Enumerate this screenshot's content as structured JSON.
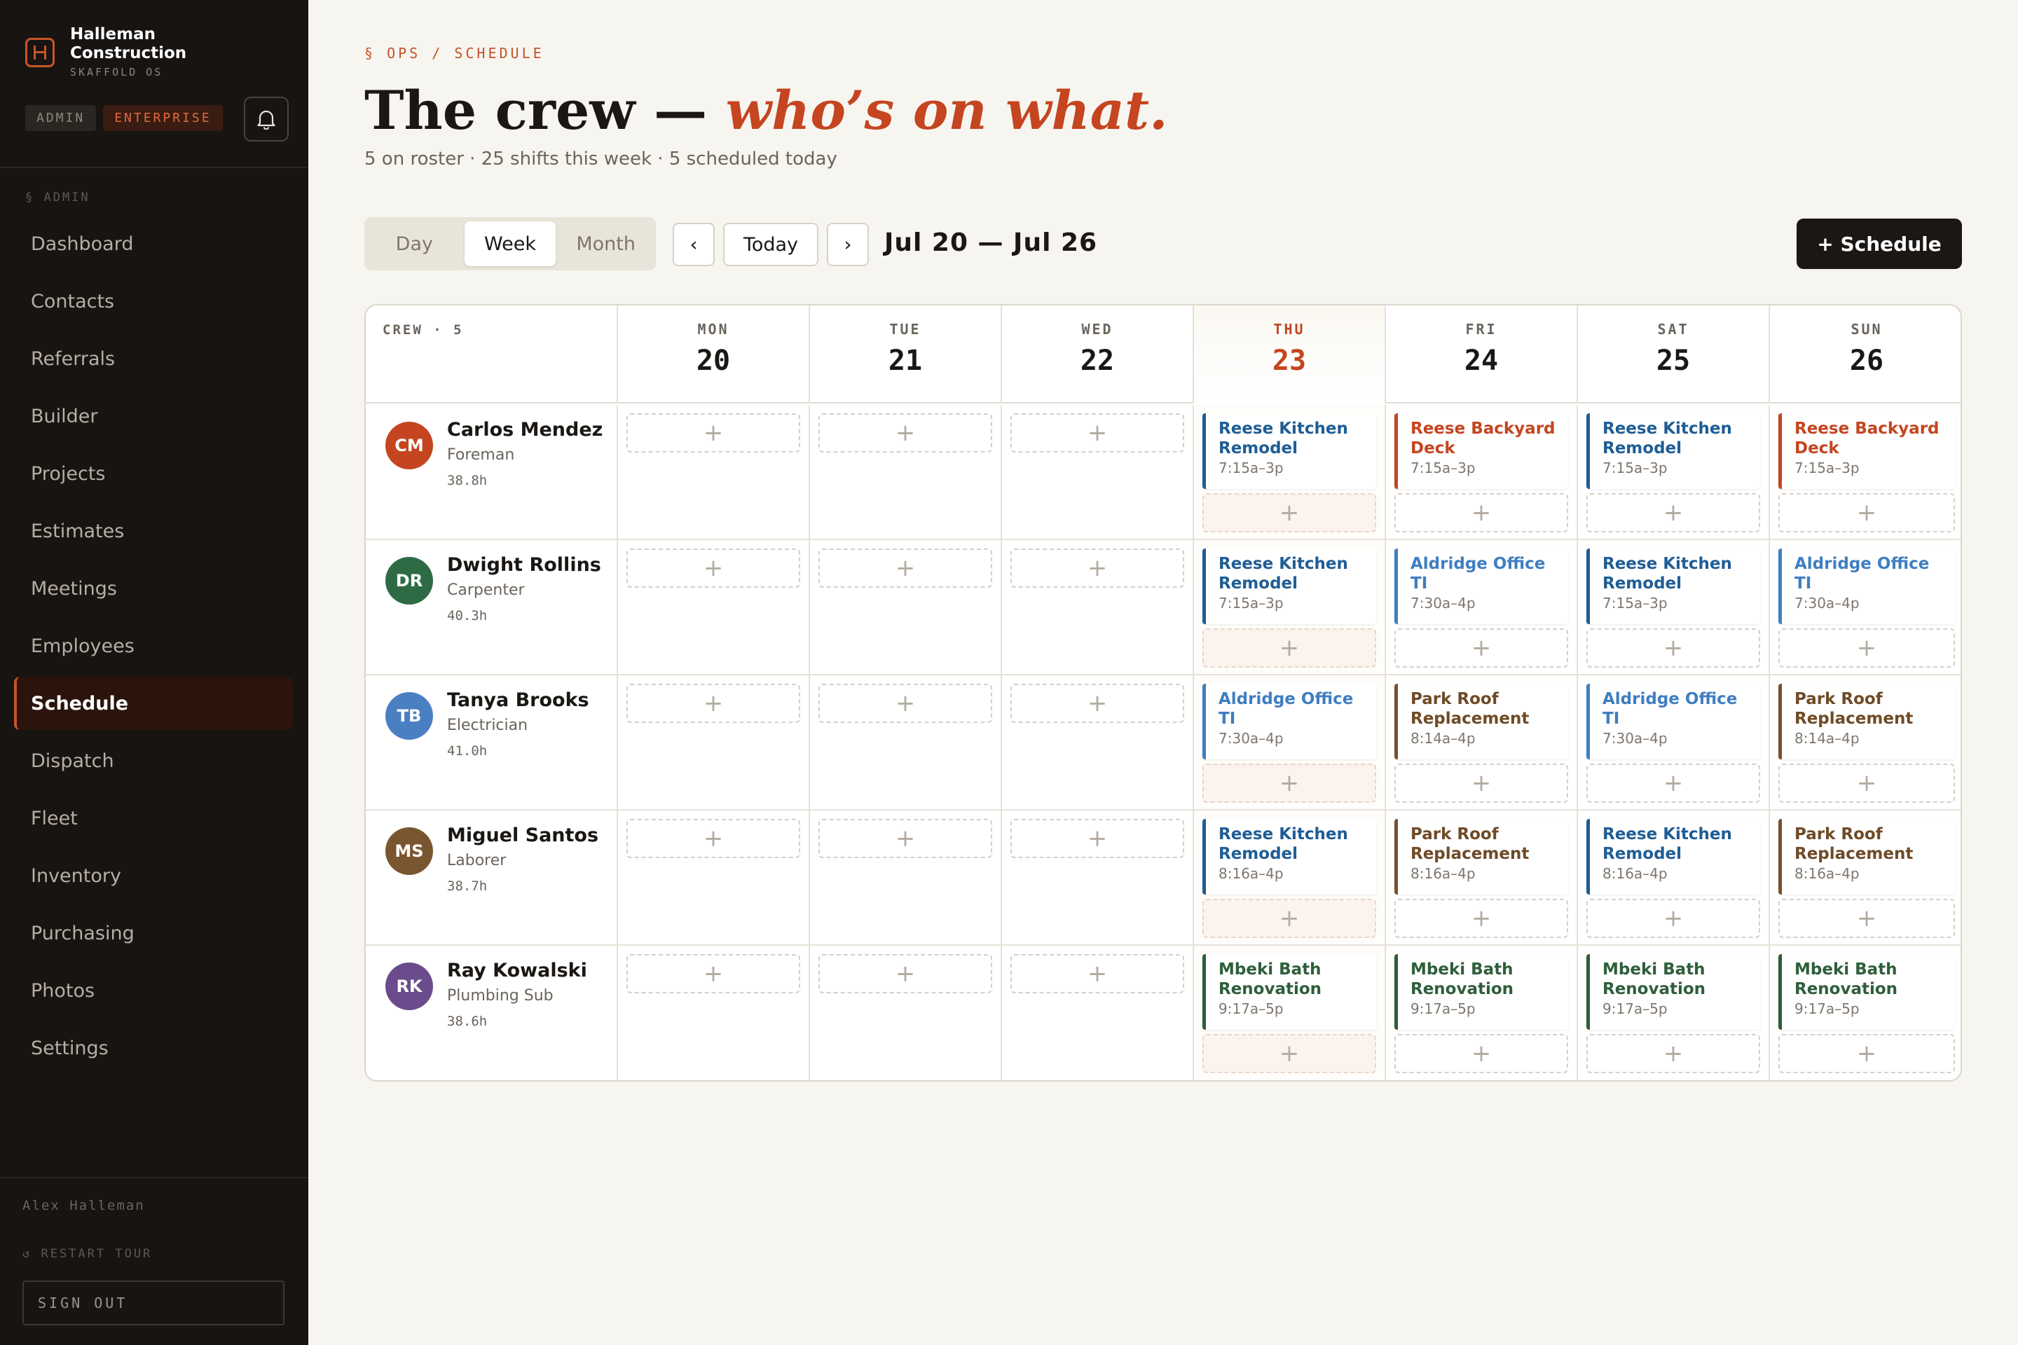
{
  "brand": {
    "name": "Halleman Construction",
    "sub": "SKAFFOLD OS"
  },
  "badges": {
    "admin": "ADMIN",
    "plan": "ENTERPRISE"
  },
  "sidebar": {
    "section": "§ ADMIN",
    "items": [
      {
        "label": "Dashboard"
      },
      {
        "label": "Contacts"
      },
      {
        "label": "Referrals"
      },
      {
        "label": "Builder"
      },
      {
        "label": "Projects"
      },
      {
        "label": "Estimates"
      },
      {
        "label": "Meetings"
      },
      {
        "label": "Employees"
      },
      {
        "label": "Schedule",
        "active": true
      },
      {
        "label": "Dispatch"
      },
      {
        "label": "Fleet"
      },
      {
        "label": "Inventory"
      },
      {
        "label": "Purchasing"
      },
      {
        "label": "Photos"
      },
      {
        "label": "Settings"
      }
    ],
    "user": "Alex Halleman",
    "restart_tour": "↺ RESTART TOUR",
    "sign_out": "SIGN OUT"
  },
  "page": {
    "breadcrumb": "§ OPS / SCHEDULE",
    "title_main": "The crew — ",
    "title_accent": "who’s on what.",
    "subtitle": "5 on roster · 25 shifts this week · 5 scheduled today"
  },
  "toolbar": {
    "views": [
      "Day",
      "Week",
      "Month"
    ],
    "active_view": "Week",
    "prev": "‹",
    "today": "Today",
    "next": "›",
    "range": "Jul 20 — Jul 26",
    "schedule_button": "+ Schedule"
  },
  "calendar": {
    "crew_header": "CREW · 5",
    "days": [
      {
        "dow": "MON",
        "num": "20"
      },
      {
        "dow": "TUE",
        "num": "21"
      },
      {
        "dow": "WED",
        "num": "22"
      },
      {
        "dow": "THU",
        "num": "23",
        "today": true
      },
      {
        "dow": "FRI",
        "num": "24"
      },
      {
        "dow": "SAT",
        "num": "25"
      },
      {
        "dow": "SUN",
        "num": "26"
      }
    ],
    "add_label": "+",
    "crew": [
      {
        "initials": "CM",
        "name": "Carlos Mendez",
        "role": "Foreman",
        "hours": "38.8h",
        "color": "#c4451f",
        "shifts": [
          null,
          null,
          null,
          {
            "title": "Reese Kitchen Remodel",
            "time": "7:15a–3p",
            "color": "blue"
          },
          {
            "title": "Reese Backyard Deck",
            "time": "7:15a–3p",
            "color": "orange"
          },
          {
            "title": "Reese Kitchen Remodel",
            "time": "7:15a–3p",
            "color": "blue"
          },
          {
            "title": "Reese Backyard Deck",
            "time": "7:15a–3p",
            "color": "orange"
          }
        ]
      },
      {
        "initials": "DR",
        "name": "Dwight Rollins",
        "role": "Carpenter",
        "hours": "40.3h",
        "color": "#2e6b45",
        "shifts": [
          null,
          null,
          null,
          {
            "title": "Reese Kitchen Remodel",
            "time": "7:15a–3p",
            "color": "blue"
          },
          {
            "title": "Aldridge Office TI",
            "time": "7:30a–4p",
            "color": "sky"
          },
          {
            "title": "Reese Kitchen Remodel",
            "time": "7:15a–3p",
            "color": "blue"
          },
          {
            "title": "Aldridge Office TI",
            "time": "7:30a–4p",
            "color": "sky"
          }
        ]
      },
      {
        "initials": "TB",
        "name": "Tanya Brooks",
        "role": "Electrician",
        "hours": "41.0h",
        "color": "#4a80c2",
        "shifts": [
          null,
          null,
          null,
          {
            "title": "Aldridge Office TI",
            "time": "7:30a–4p",
            "color": "sky"
          },
          {
            "title": "Park Roof Replacement",
            "time": "8:14a–4p",
            "color": "brown"
          },
          {
            "title": "Aldridge Office TI",
            "time": "7:30a–4p",
            "color": "sky"
          },
          {
            "title": "Park Roof Replacement",
            "time": "8:14a–4p",
            "color": "brown"
          }
        ]
      },
      {
        "initials": "MS",
        "name": "Miguel Santos",
        "role": "Laborer",
        "hours": "38.7h",
        "color": "#7a5630",
        "shifts": [
          null,
          null,
          null,
          {
            "title": "Reese Kitchen Remodel",
            "time": "8:16a–4p",
            "color": "blue"
          },
          {
            "title": "Park Roof Replacement",
            "time": "8:16a–4p",
            "color": "brown"
          },
          {
            "title": "Reese Kitchen Remodel",
            "time": "8:16a–4p",
            "color": "blue"
          },
          {
            "title": "Park Roof Replacement",
            "time": "8:16a–4p",
            "color": "brown"
          }
        ]
      },
      {
        "initials": "RK",
        "name": "Ray Kowalski",
        "role": "Plumbing Sub",
        "hours": "38.6h",
        "color": "#6a4c8c",
        "shifts": [
          null,
          null,
          null,
          {
            "title": "Mbeki Bath Renovation",
            "time": "9:17a–5p",
            "color": "green"
          },
          {
            "title": "Mbeki Bath Renovation",
            "time": "9:17a–5p",
            "color": "green"
          },
          {
            "title": "Mbeki Bath Renovation",
            "time": "9:17a–5p",
            "color": "green"
          },
          {
            "title": "Mbeki Bath Renovation",
            "time": "9:17a–5p",
            "color": "green"
          }
        ]
      }
    ]
  }
}
